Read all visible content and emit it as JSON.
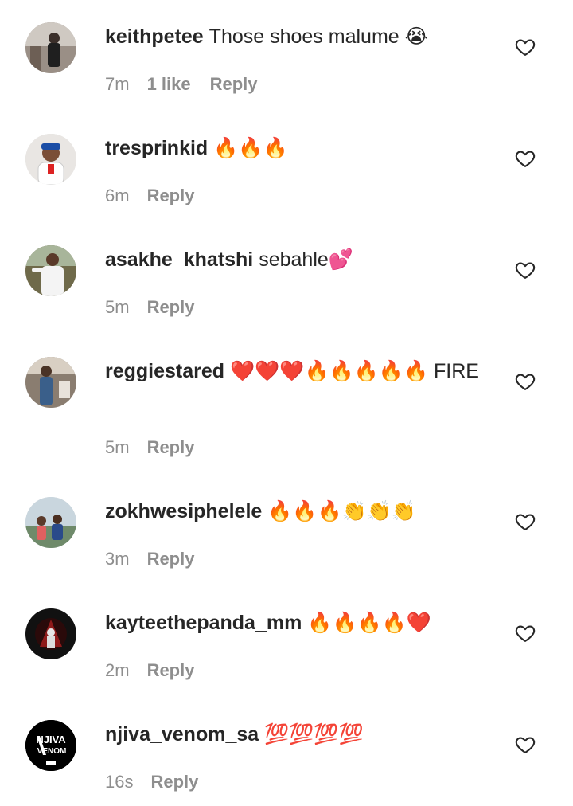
{
  "comments": [
    {
      "username": "keithpetee",
      "text": "Those shoes malume 😭",
      "time": "7m",
      "likes": "1 like",
      "reply": "Reply"
    },
    {
      "username": "tresprinkid",
      "text": "🔥🔥🔥",
      "time": "6m",
      "likes": "",
      "reply": "Reply"
    },
    {
      "username": "asakhe_khatshi",
      "text": "sebahle💕",
      "time": "5m",
      "likes": "",
      "reply": "Reply"
    },
    {
      "username": "reggiestared",
      "text": "❤️❤️❤️🔥🔥🔥🔥🔥 FIRE",
      "time": "5m",
      "likes": "",
      "reply": "Reply"
    },
    {
      "username": "zokhwesiphelele",
      "text": "🔥🔥🔥👏👏👏",
      "time": "3m",
      "likes": "",
      "reply": "Reply"
    },
    {
      "username": "kayteethepanda_mm",
      "text": "🔥🔥🔥🔥❤️",
      "time": "2m",
      "likes": "",
      "reply": "Reply"
    },
    {
      "username": "njiva_venom_sa",
      "text": "💯💯💯💯",
      "time": "16s",
      "likes": "",
      "reply": "Reply"
    }
  ],
  "avatars": {
    "njiva_venom_sa": {
      "line1": "NJIVA",
      "line2": "VENOM"
    }
  },
  "icons": {
    "like": "heart-outline-icon"
  },
  "colors": {
    "text": "#262626",
    "meta": "#8e8e8e"
  }
}
